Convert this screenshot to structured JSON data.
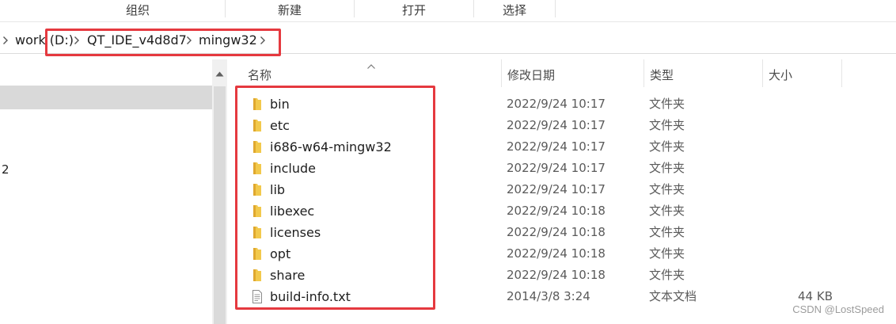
{
  "ribbon": {
    "groups": [
      "组织",
      "新建",
      "打开",
      "选择"
    ]
  },
  "address": {
    "segments": [
      "work (D:)",
      "QT_IDE_v4d8d7",
      "mingw32"
    ]
  },
  "nav": {
    "truncated_item": "2"
  },
  "columns": {
    "name": "名称",
    "date": "修改日期",
    "type": "类型",
    "size": "大小"
  },
  "files": [
    {
      "name": "bin",
      "date": "2022/9/24 10:17",
      "type": "文件夹",
      "size": "",
      "icon": "folder-icon"
    },
    {
      "name": "etc",
      "date": "2022/9/24 10:17",
      "type": "文件夹",
      "size": "",
      "icon": "folder-icon"
    },
    {
      "name": "i686-w64-mingw32",
      "date": "2022/9/24 10:17",
      "type": "文件夹",
      "size": "",
      "icon": "folder-icon"
    },
    {
      "name": "include",
      "date": "2022/9/24 10:17",
      "type": "文件夹",
      "size": "",
      "icon": "folder-icon"
    },
    {
      "name": "lib",
      "date": "2022/9/24 10:17",
      "type": "文件夹",
      "size": "",
      "icon": "folder-icon"
    },
    {
      "name": "libexec",
      "date": "2022/9/24 10:18",
      "type": "文件夹",
      "size": "",
      "icon": "folder-icon"
    },
    {
      "name": "licenses",
      "date": "2022/9/24 10:18",
      "type": "文件夹",
      "size": "",
      "icon": "folder-icon"
    },
    {
      "name": "opt",
      "date": "2022/9/24 10:18",
      "type": "文件夹",
      "size": "",
      "icon": "folder-icon"
    },
    {
      "name": "share",
      "date": "2022/9/24 10:18",
      "type": "文件夹",
      "size": "",
      "icon": "folder-icon"
    },
    {
      "name": "build-info.txt",
      "date": "2014/3/8 3:24",
      "type": "文本文档",
      "size": "44 KB",
      "icon": "text-file-icon"
    }
  ],
  "watermark": "CSDN @LostSpeed",
  "colors": {
    "highlight_border": "#e5393f",
    "folder_yellow": "#f2c94c",
    "nav_selected": "#d9d9d9"
  }
}
